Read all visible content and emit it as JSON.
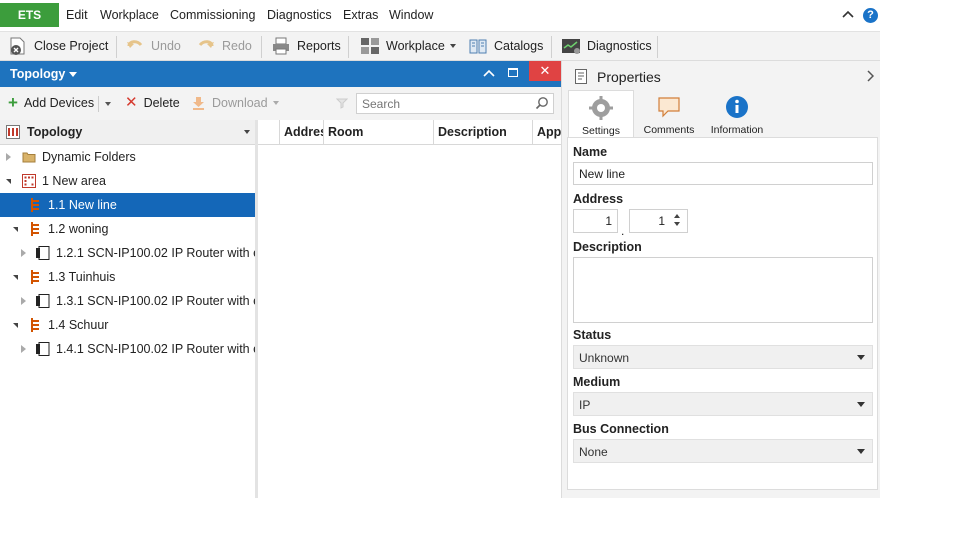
{
  "menubar": {
    "app_button": "ETS",
    "items": [
      "Edit",
      "Workplace",
      "Commissioning",
      "Diagnostics",
      "Extras",
      "Window"
    ]
  },
  "toolbar": {
    "close_project": "Close Project",
    "undo": "Undo",
    "redo": "Redo",
    "reports": "Reports",
    "workplace": "Workplace",
    "catalogs": "Catalogs",
    "diagnostics": "Diagnostics"
  },
  "topology": {
    "panel_title": "Topology",
    "add_devices": "Add Devices",
    "delete": "Delete",
    "download": "Download",
    "search_placeholder": "Search",
    "tree_header": "Topology",
    "tree": [
      {
        "label": "Dynamic Folders",
        "level": 0,
        "state": "collapsed",
        "icon": "folder-icon",
        "selected": false
      },
      {
        "label": "1 New area",
        "level": 0,
        "state": "expanded",
        "icon": "area-icon",
        "selected": false
      },
      {
        "label": "1.1 New line",
        "level": 1,
        "state": "none",
        "icon": "line-icon",
        "selected": true
      },
      {
        "label": "1.2 woning",
        "level": 1,
        "state": "expanded",
        "icon": "line-icon",
        "selected": false
      },
      {
        "label": "1.2.1 SCN-IP100.02 IP Router with e...",
        "level": 2,
        "state": "collapsed",
        "icon": "device-icon",
        "selected": false
      },
      {
        "label": "1.3 Tuinhuis",
        "level": 1,
        "state": "expanded",
        "icon": "line-icon",
        "selected": false
      },
      {
        "label": "1.3.1 SCN-IP100.02 IP Router with e...",
        "level": 2,
        "state": "collapsed",
        "icon": "device-icon",
        "selected": false
      },
      {
        "label": "1.4 Schuur",
        "level": 1,
        "state": "expanded",
        "icon": "line-icon",
        "selected": false
      },
      {
        "label": "1.4.1 SCN-IP100.02 IP Router with e...",
        "level": 2,
        "state": "collapsed",
        "icon": "device-icon",
        "selected": false
      }
    ],
    "grid_columns": [
      "Addres",
      "Room",
      "Description",
      "App"
    ]
  },
  "properties": {
    "title": "Properties",
    "tabs": [
      "Settings",
      "Comments",
      "Information"
    ],
    "name_label": "Name",
    "name_value": "New line",
    "address_label": "Address",
    "address_area": "1",
    "address_line": "1",
    "address_separator": ".",
    "description_label": "Description",
    "description_value": "",
    "status_label": "Status",
    "status_value": "Unknown",
    "medium_label": "Medium",
    "medium_value": "IP",
    "bus_label": "Bus Connection",
    "bus_value": "None"
  },
  "colors": {
    "ets_green": "#3c9d3c",
    "panel_blue": "#1e73be",
    "selection_blue": "#1467b8",
    "close_red": "#e04343"
  }
}
